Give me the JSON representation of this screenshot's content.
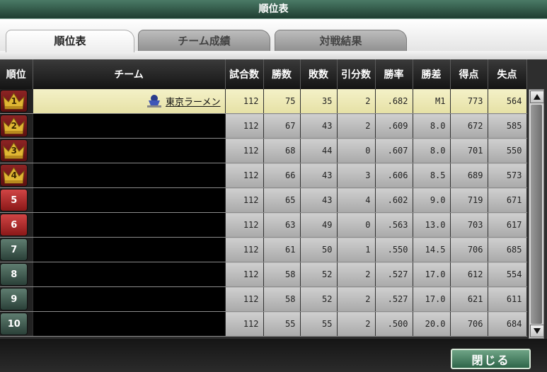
{
  "window": {
    "title": "順位表"
  },
  "tabs": [
    {
      "label": "順位表",
      "active": true
    },
    {
      "label": "チーム成績",
      "active": false
    },
    {
      "label": "対戦結果",
      "active": false
    }
  ],
  "table": {
    "headers": [
      "順位",
      "チーム",
      "試合数",
      "勝数",
      "敗数",
      "引分数",
      "勝率",
      "勝差",
      "得点",
      "失点"
    ],
    "rows": [
      {
        "rank": "1",
        "team": "東京ラーメン",
        "games": "112",
        "wins": "75",
        "losses": "35",
        "draws": "2",
        "pct": ".682",
        "gb": "M1",
        "runs": "773",
        "runs_allowed": "564"
      },
      {
        "rank": "2",
        "team": "",
        "games": "112",
        "wins": "67",
        "losses": "43",
        "draws": "2",
        "pct": ".609",
        "gb": "8.0",
        "runs": "672",
        "runs_allowed": "585"
      },
      {
        "rank": "3",
        "team": "",
        "games": "112",
        "wins": "68",
        "losses": "44",
        "draws": "0",
        "pct": ".607",
        "gb": "8.0",
        "runs": "701",
        "runs_allowed": "550"
      },
      {
        "rank": "4",
        "team": "",
        "games": "112",
        "wins": "66",
        "losses": "43",
        "draws": "3",
        "pct": ".606",
        "gb": "8.5",
        "runs": "689",
        "runs_allowed": "573"
      },
      {
        "rank": "5",
        "team": "",
        "games": "112",
        "wins": "65",
        "losses": "43",
        "draws": "4",
        "pct": ".602",
        "gb": "9.0",
        "runs": "719",
        "runs_allowed": "671"
      },
      {
        "rank": "6",
        "team": "",
        "games": "112",
        "wins": "63",
        "losses": "49",
        "draws": "0",
        "pct": ".563",
        "gb": "13.0",
        "runs": "703",
        "runs_allowed": "617"
      },
      {
        "rank": "7",
        "team": "",
        "games": "112",
        "wins": "61",
        "losses": "50",
        "draws": "1",
        "pct": ".550",
        "gb": "14.5",
        "runs": "706",
        "runs_allowed": "685"
      },
      {
        "rank": "8",
        "team": "",
        "games": "112",
        "wins": "58",
        "losses": "52",
        "draws": "2",
        "pct": ".527",
        "gb": "17.0",
        "runs": "612",
        "runs_allowed": "554"
      },
      {
        "rank": "9",
        "team": "",
        "games": "112",
        "wins": "58",
        "losses": "52",
        "draws": "2",
        "pct": ".527",
        "gb": "17.0",
        "runs": "621",
        "runs_allowed": "611"
      },
      {
        "rank": "10",
        "team": "",
        "games": "112",
        "wins": "55",
        "losses": "55",
        "draws": "2",
        "pct": ".500",
        "gb": "20.0",
        "runs": "706",
        "runs_allowed": "684"
      }
    ]
  },
  "buttons": {
    "close": "閉じる"
  },
  "icons": {
    "crown": "crown-icon",
    "team_logo": "team-logo-icon",
    "scroll_up": "arrow-up-icon",
    "scroll_down": "arrow-down-icon"
  },
  "colors": {
    "title_green": "#2e5a48",
    "highlight_row": "#f0ecbf",
    "magic_number_red": "#c01010",
    "close_button": "#4f8a6a"
  }
}
